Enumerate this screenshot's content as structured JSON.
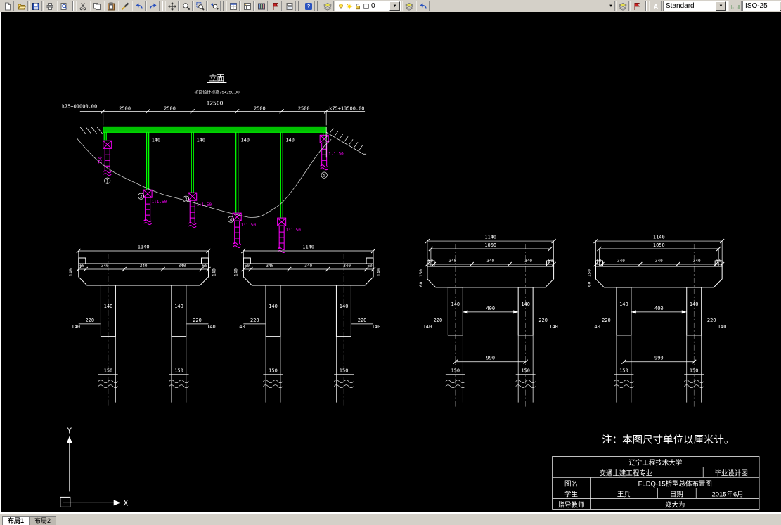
{
  "app": {
    "toolbar": {
      "layer_value": "0",
      "text_style": "Standard",
      "dim_style": "ISO-25",
      "overflow_arrow": "▼"
    },
    "tabs": [
      {
        "label": "布局1"
      },
      {
        "label": "布局2"
      }
    ]
  },
  "icons": {
    "new-icon": "blank-page",
    "open-icon": "folder",
    "save-icon": "floppy-disk",
    "print-icon": "printer",
    "preview-icon": "page-with-magnifier",
    "cut-icon": "scissors",
    "copy-icon": "two-pages",
    "paste-icon": "clipboard",
    "match-props-icon": "paintbrush",
    "undo-icon": "curved-arrow-left",
    "redo-icon": "curved-arrow-right",
    "pan-icon": "four-way-arrows",
    "zoom-realtime-icon": "magnifier",
    "zoom-window-icon": "magnifier-with-window",
    "zoom-previous-icon": "magnifier-with-back-arrow",
    "properties-icon": "palette-window",
    "designcenter-icon": "grid-window",
    "tool-palettes-icon": "color-bars",
    "markup-icon": "red-flag",
    "calculator-icon": "calculator",
    "help-icon": "blue-question-mark",
    "layer-manager-icon": "stacked-layers",
    "bulb-icon": "lightbulb",
    "sun-icon": "sun",
    "lock-icon": "padlock",
    "color-swatch-icon": "white-square",
    "text-style-icon": "letter-A",
    "dim-style-icon": "dimension-line-arrows",
    "dropdown-arrow-icon": "small-triangle-down"
  },
  "drawing": {
    "elevation": {
      "title": "立面",
      "deck_note": "桥面设计标高75+250.00",
      "station_left": "k75+01000.00",
      "station_right": "k75+13500.00",
      "total_length": "12500",
      "span": "2500",
      "seg_height": "140",
      "slope": "1:1.50",
      "abutment_pile": "150",
      "pier_marks": [
        "1",
        "2",
        "3",
        "4",
        "5"
      ]
    },
    "section_left": {
      "total_width": "1140",
      "edge": "60",
      "lane": "340",
      "cap_end_h": "140",
      "column_w": "140",
      "offset_a": "220",
      "offset_b": "140",
      "pile_d": "150"
    },
    "section_right": {
      "total_width": "1140",
      "road_width": "1050",
      "edge": "60",
      "lane": "340",
      "cap_h": "150",
      "cap_edge": "60",
      "column_w": "140",
      "column_gap": "400",
      "offset_a": "220",
      "offset_b": "140",
      "pile_spacing": "990",
      "pile_d": "150"
    },
    "note": "注：本图尺寸单位以厘米计。"
  },
  "title_block": {
    "university": "辽宁工程技术大学",
    "department": "交通土建工程专业",
    "project_type": "毕业设计图",
    "drawing_name_label": "图名",
    "drawing_name": "FLDQ-15桥型总体布置图",
    "student_label": "学生",
    "student_name": "王兵",
    "date_label": "日期",
    "date_value": "2015年6月",
    "advisor_label": "指导教师",
    "advisor_name": "郑大为"
  },
  "ucs": {
    "x_label": "X",
    "y_label": "Y"
  }
}
